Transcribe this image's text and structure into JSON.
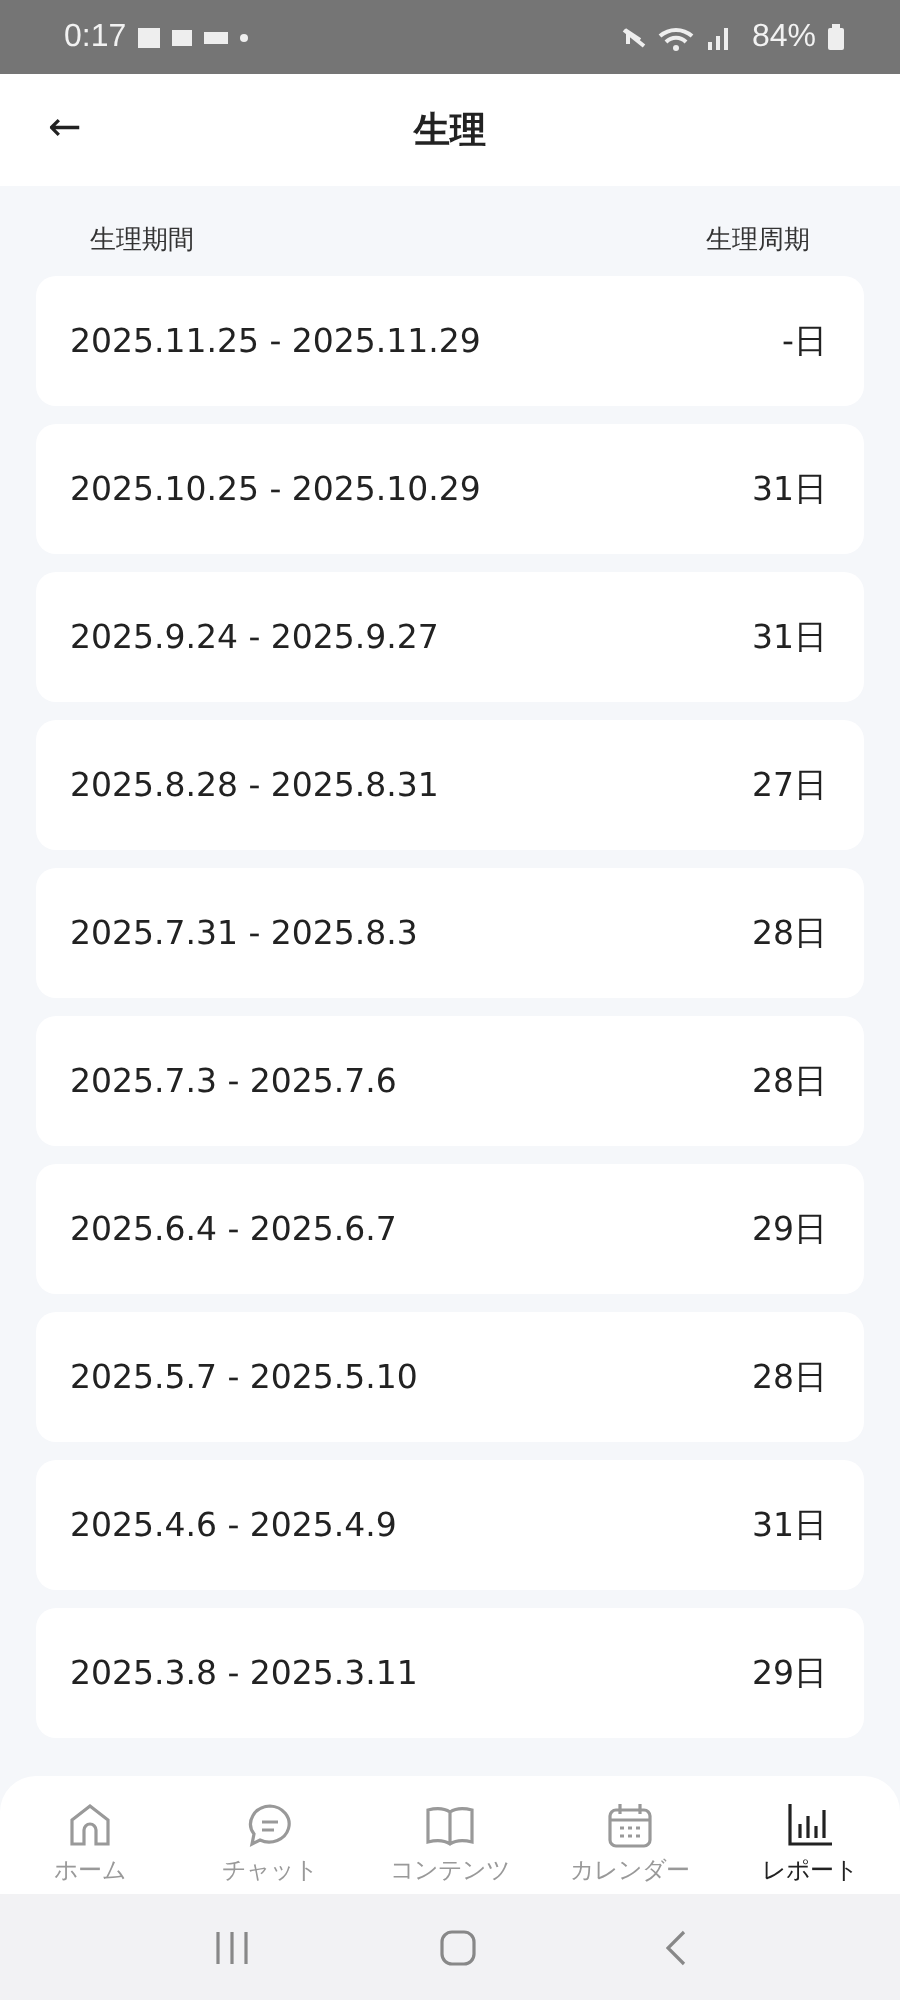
{
  "status_bar": {
    "time": "0:17",
    "battery": "84%"
  },
  "header": {
    "back": "←",
    "title": "生理"
  },
  "columns": [
    "生理期間",
    "生理周期"
  ],
  "rows": [
    {
      "period": "2025.11.25 - 2025.11.29",
      "cycle": "-日"
    },
    {
      "period": "2025.10.25 - 2025.10.29",
      "cycle": "31日"
    },
    {
      "period": "2025.9.24 - 2025.9.27",
      "cycle": "31日"
    },
    {
      "period": "2025.8.28 - 2025.8.31",
      "cycle": "27日"
    },
    {
      "period": "2025.7.31 - 2025.8.3",
      "cycle": "28日"
    },
    {
      "period": "2025.7.3 - 2025.7.6",
      "cycle": "28日"
    },
    {
      "period": "2025.6.4 - 2025.6.7",
      "cycle": "29日"
    },
    {
      "period": "2025.5.7 - 2025.5.10",
      "cycle": "28日"
    },
    {
      "period": "2025.4.6 - 2025.4.9",
      "cycle": "31日"
    },
    {
      "period": "2025.3.8 - 2025.3.11",
      "cycle": "29日"
    }
  ],
  "tabs": [
    {
      "kind": "home",
      "label": "ホーム",
      "selected": false
    },
    {
      "kind": "chat",
      "label": "チャット",
      "selected": false
    },
    {
      "kind": "contents",
      "label": "コンテンツ",
      "selected": false
    },
    {
      "kind": "calendar",
      "label": "カレンダー",
      "selected": false
    },
    {
      "kind": "report",
      "label": "レポート",
      "selected": true
    }
  ]
}
